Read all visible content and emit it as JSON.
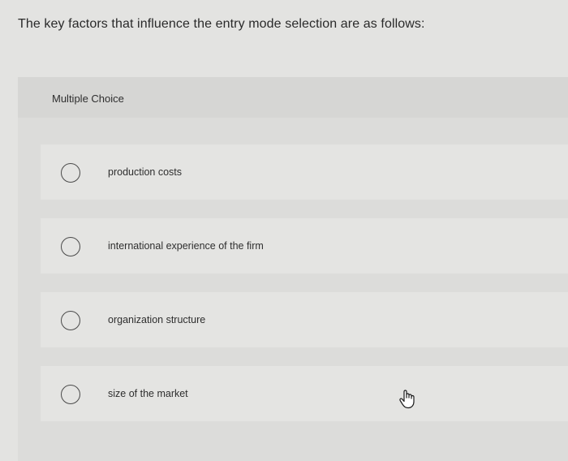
{
  "question": {
    "text": "The key factors that influence the entry mode selection are as follows:"
  },
  "panel": {
    "type_label": "Multiple Choice",
    "options": [
      {
        "label": "production costs"
      },
      {
        "label": "international experience of the firm"
      },
      {
        "label": "organization structure"
      },
      {
        "label": "size of the market"
      }
    ]
  },
  "icons": {
    "radio": "radio-unchecked-icon",
    "cursor": "hand-pointer-icon"
  },
  "colors": {
    "background": "#e3e3e1",
    "panel": "#dcdcda",
    "option_card": "#e4e4e2",
    "text": "#2b2b2b"
  }
}
